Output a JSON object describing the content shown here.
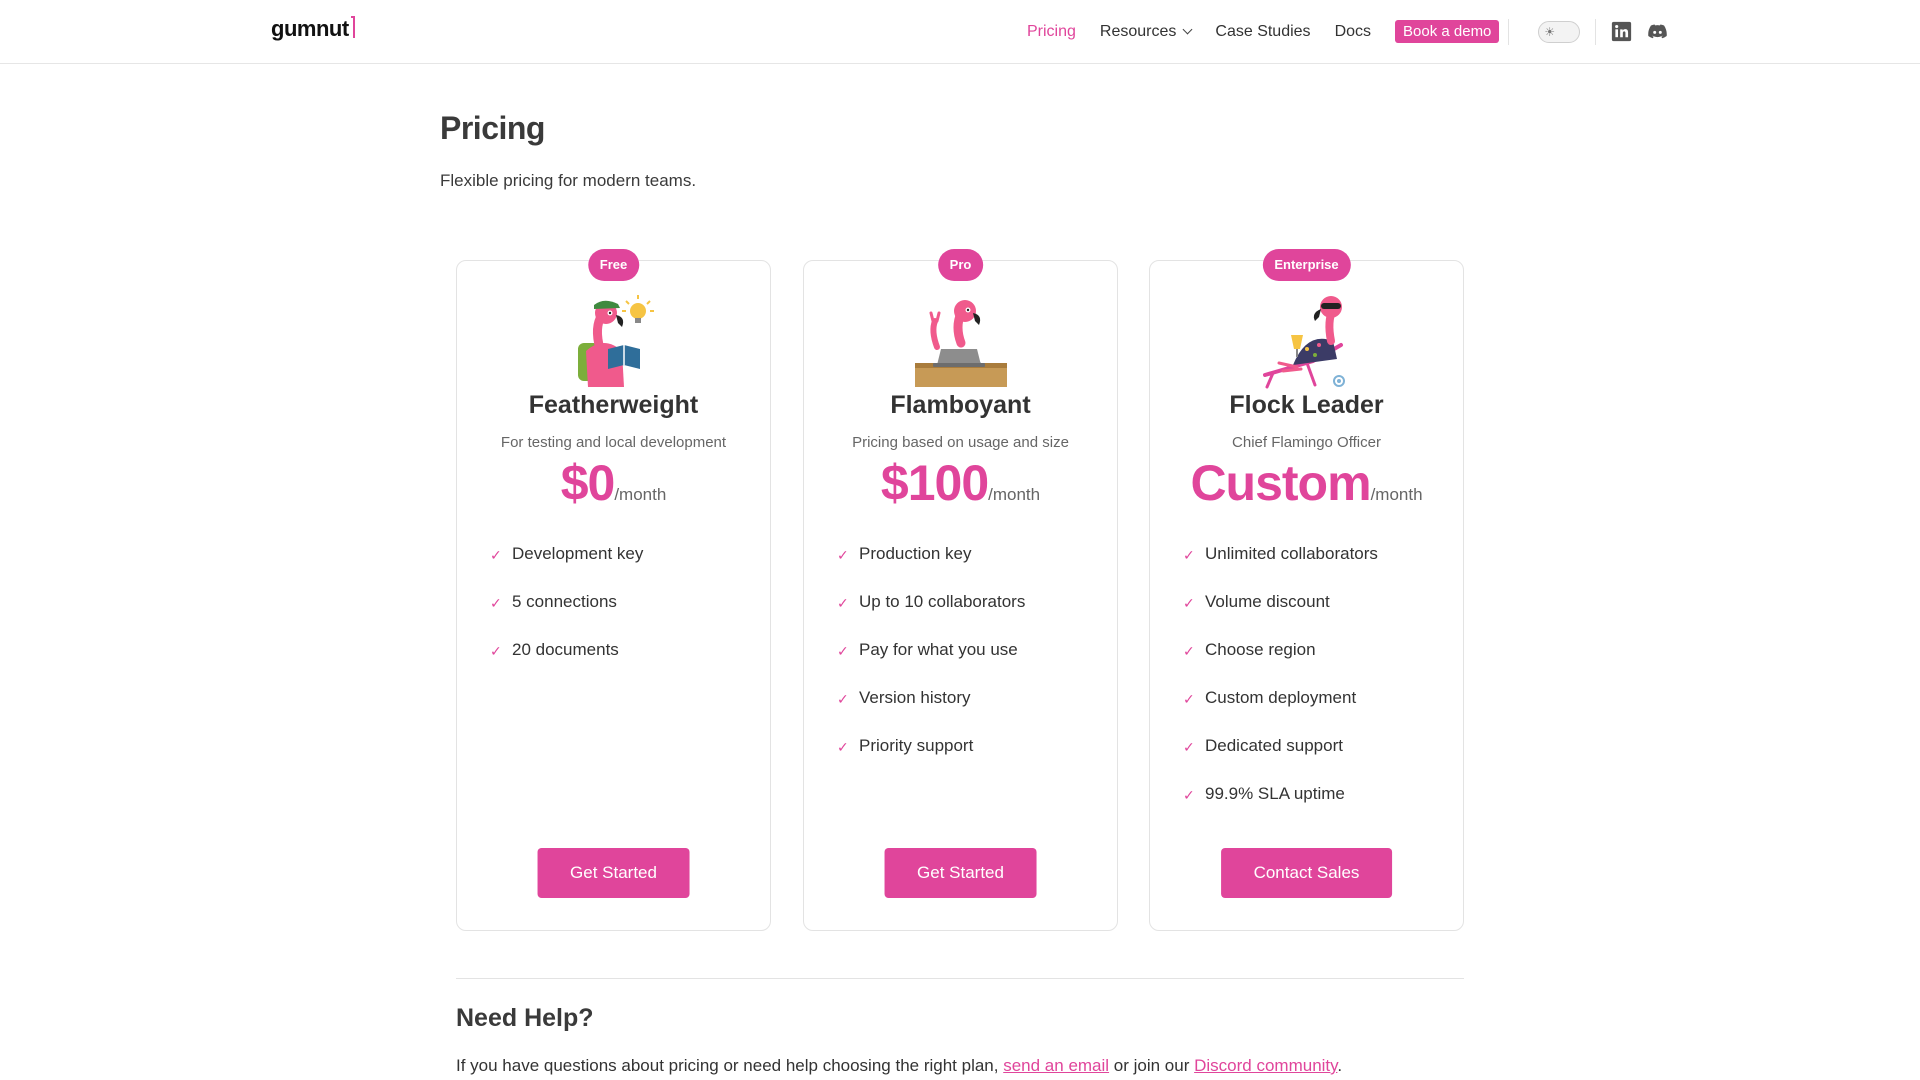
{
  "header": {
    "logo": "gumnut",
    "nav": [
      "Pricing",
      "Resources",
      "Case Studies",
      "Docs"
    ],
    "demo_label": "Book a demo",
    "theme_icon": "sun-icon",
    "social_icons": [
      "linkedin-icon",
      "discord-icon"
    ]
  },
  "page": {
    "title": "Pricing",
    "subtitle": "Flexible pricing for modern teams."
  },
  "plans": [
    {
      "badge": "Free",
      "name": "Featherweight",
      "description": "For testing and local development",
      "price": "$0",
      "period": "/month",
      "features": [
        "Development key",
        "5 connections",
        "20 documents"
      ],
      "cta": "Get Started"
    },
    {
      "badge": "Pro",
      "name": "Flamboyant",
      "description": "Pricing based on usage and size",
      "price": "$100",
      "period": "/month",
      "features": [
        "Production key",
        "Up to 10 collaborators",
        "Pay for what you use",
        "Version history",
        "Priority support"
      ],
      "cta": "Get Started"
    },
    {
      "badge": "Enterprise",
      "name": "Flock Leader",
      "description": "Chief Flamingo Officer",
      "price": "Custom",
      "period": "/month",
      "features": [
        "Unlimited collaborators",
        "Volume discount",
        "Choose region",
        "Custom deployment",
        "Dedicated support",
        "99.9% SLA uptime"
      ],
      "cta": "Contact Sales"
    }
  ],
  "help": {
    "title": "Need Help?",
    "text_before": "If you have questions about pricing or need help choosing the right plan, ",
    "email_link": "send an email",
    "text_middle": " or join our ",
    "discord_link": "Discord community",
    "text_after": "."
  },
  "colors": {
    "accent": "#e0459b",
    "text": "#333333",
    "muted": "#666666",
    "border": "#e3e3e3"
  }
}
